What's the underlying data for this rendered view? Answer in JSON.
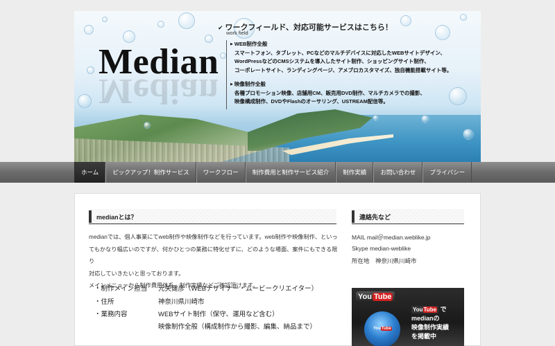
{
  "header": {
    "logo": "Median",
    "headline": "ワークフィールド、対応可能サービスはこちら！",
    "subhead": "work field",
    "services": [
      {
        "title": "WEB制作全般",
        "lines": [
          "スマートフォン、タブレット、PCなどのマルチデバイスに対応したWEBサイトデザイン、",
          "WordPressなどのCMSシステムを導入したサイト制作、ショッピングサイト制作、",
          "コーポレートサイト、ランディングページ、アメブロカスタマイズ、独自機能搭載サイト等。"
        ]
      },
      {
        "title": "映像制作全般",
        "lines": [
          "各種プロモーション映像、店舗用CM、販売用DVD制作、マルチカメラでの撮影、",
          "映像構成制作、DVDやFlashのオーサリング、USTREAM配信等。"
        ]
      }
    ]
  },
  "nav": {
    "items": [
      {
        "label": "ホーム",
        "active": true
      },
      {
        "label": "ピックアップ！制作サービス"
      },
      {
        "label": "ワークフロー"
      },
      {
        "label": "制作費用と制作サービス紹介"
      },
      {
        "label": "制作実績"
      },
      {
        "label": "お問い合わせ"
      },
      {
        "label": "プライバシー"
      }
    ]
  },
  "main": {
    "section_title": "medianとは？",
    "paragraphs": [
      "medianでは、個人事業にてweb制作や映像制作などを行っています。web制作や映像制作、といっ",
      "てもかなり幅広いのですが、何かひとつの業務に特化せずに、どのような場面、案件にもできる限り",
      "対応していきたいと思っております。",
      "メインメニューから制作費用体系、制作実績などご確認頂けます。"
    ],
    "info": [
      {
        "key": "・制作メイン担当",
        "value": "元矢健彦（WEBデザイナー・ムービークリエイター）"
      },
      {
        "key": "・住所",
        "value": "神奈川県川崎市"
      },
      {
        "key": "・業務内容",
        "value": "WEBサイト制作（保守、運用など含む）"
      },
      {
        "key": "",
        "value": "映像制作全般（構成制作から撮影、編集、納品まで）"
      }
    ]
  },
  "sidebar": {
    "section_title": "連絡先など",
    "mail": "MAIL mail＠median.weblike.jp",
    "skype": "Skype median-weblike",
    "location": "所在地　神奈川県川崎市",
    "banner": {
      "logo_you": "You",
      "logo_tube": "Tube",
      "ball_you": "You",
      "ball_tube": "Tube",
      "mini_you": "You",
      "mini_tube": "Tube",
      "line1_suffix": "で",
      "line2": "medianの",
      "line3": "映像制作実績",
      "line4": "を掲載中"
    }
  }
}
